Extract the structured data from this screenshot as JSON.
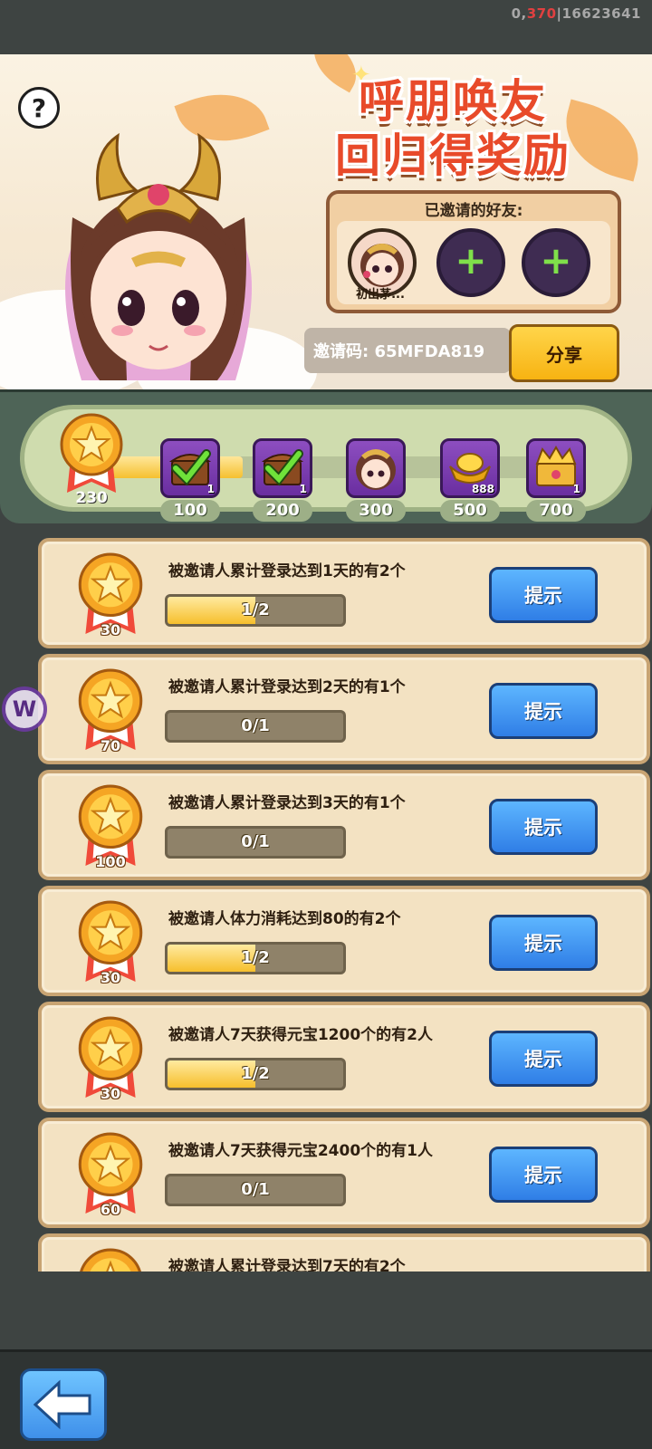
{
  "status": {
    "prefix": "0,",
    "highlight": "370",
    "suffix": "|16623641"
  },
  "banner": {
    "title_line1": "呼朋唤友",
    "title_line2": "回归得奖励",
    "help_label": "?",
    "invited_panel": {
      "title": "已邀请的好友:",
      "friends": [
        {
          "name": "初出茅..."
        }
      ],
      "empty_slot_icon": "+"
    },
    "invite_code_text": "邀请码: 65MFDA819",
    "share_label": "分享"
  },
  "progress": {
    "total": "230",
    "fill_fraction": 0.29,
    "milestones": [
      {
        "label": "100",
        "icon": "chest-checked-icon",
        "qty": "1"
      },
      {
        "label": "200",
        "icon": "chest-checked-icon",
        "qty": "1"
      },
      {
        "label": "300",
        "icon": "hero-portrait-icon",
        "qty": ""
      },
      {
        "label": "500",
        "icon": "gold-ingot-icon",
        "qty": "888"
      },
      {
        "label": "700",
        "icon": "golden-chest-icon",
        "qty": "1"
      }
    ]
  },
  "tasks": [
    {
      "reward": "30",
      "desc": "被邀请人累计登录达到1天的有2个",
      "progress_text": "1/2",
      "progress": 0.5,
      "button": "提示"
    },
    {
      "reward": "70",
      "desc": "被邀请人累计登录达到2天的有1个",
      "progress_text": "0/1",
      "progress": 0,
      "button": "提示"
    },
    {
      "reward": "100",
      "desc": "被邀请人累计登录达到3天的有1个",
      "progress_text": "0/1",
      "progress": 0,
      "button": "提示"
    },
    {
      "reward": "30",
      "desc": "被邀请人体力消耗达到80的有2个",
      "progress_text": "1/2",
      "progress": 0.5,
      "button": "提示"
    },
    {
      "reward": "30",
      "desc": "被邀请人7天获得元宝1200个的有2人",
      "progress_text": "1/2",
      "progress": 0.5,
      "button": "提示"
    },
    {
      "reward": "60",
      "desc": "被邀请人7天获得元宝2400个的有1人",
      "progress_text": "0/1",
      "progress": 0,
      "button": "提示"
    },
    {
      "reward": "",
      "desc": "被邀请人累计登录达到7天的有2个",
      "progress_text": "",
      "progress": 0,
      "button": ""
    }
  ],
  "floating_badge": "W",
  "colors": {
    "accent_title": "#e84a2a",
    "hint_button": "#2f7ee6",
    "share_button": "#f7b312",
    "progress_fill": "#f5c030"
  }
}
